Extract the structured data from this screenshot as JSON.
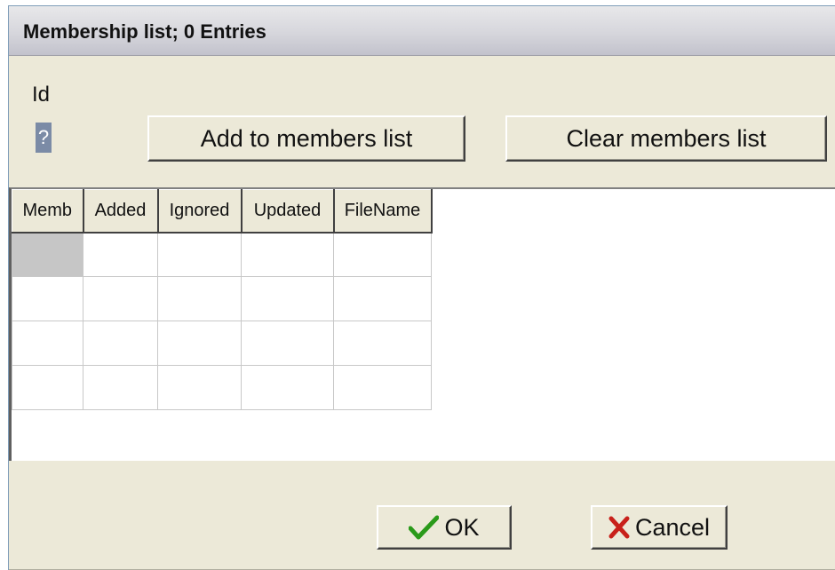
{
  "window": {
    "title": "Membership list; 0 Entries"
  },
  "form": {
    "id_label": "Id",
    "id_value": "?"
  },
  "buttons": {
    "add_label": "Add to members list",
    "clear_label": "Clear members list",
    "ok_label": "OK",
    "cancel_label": "Cancel",
    "ok_icon": "checkmark-icon",
    "cancel_icon": "x-icon",
    "ok_icon_color": "#2a9a1a",
    "cancel_icon_color": "#c8201a"
  },
  "grid": {
    "columns": [
      "Memb",
      "Added",
      "Ignored",
      "Updated",
      "FileName"
    ],
    "rows": [
      [
        "",
        "",
        "",
        "",
        ""
      ],
      [
        "",
        "",
        "",
        "",
        ""
      ],
      [
        "",
        "",
        "",
        "",
        ""
      ],
      [
        "",
        "",
        "",
        "",
        ""
      ]
    ]
  }
}
